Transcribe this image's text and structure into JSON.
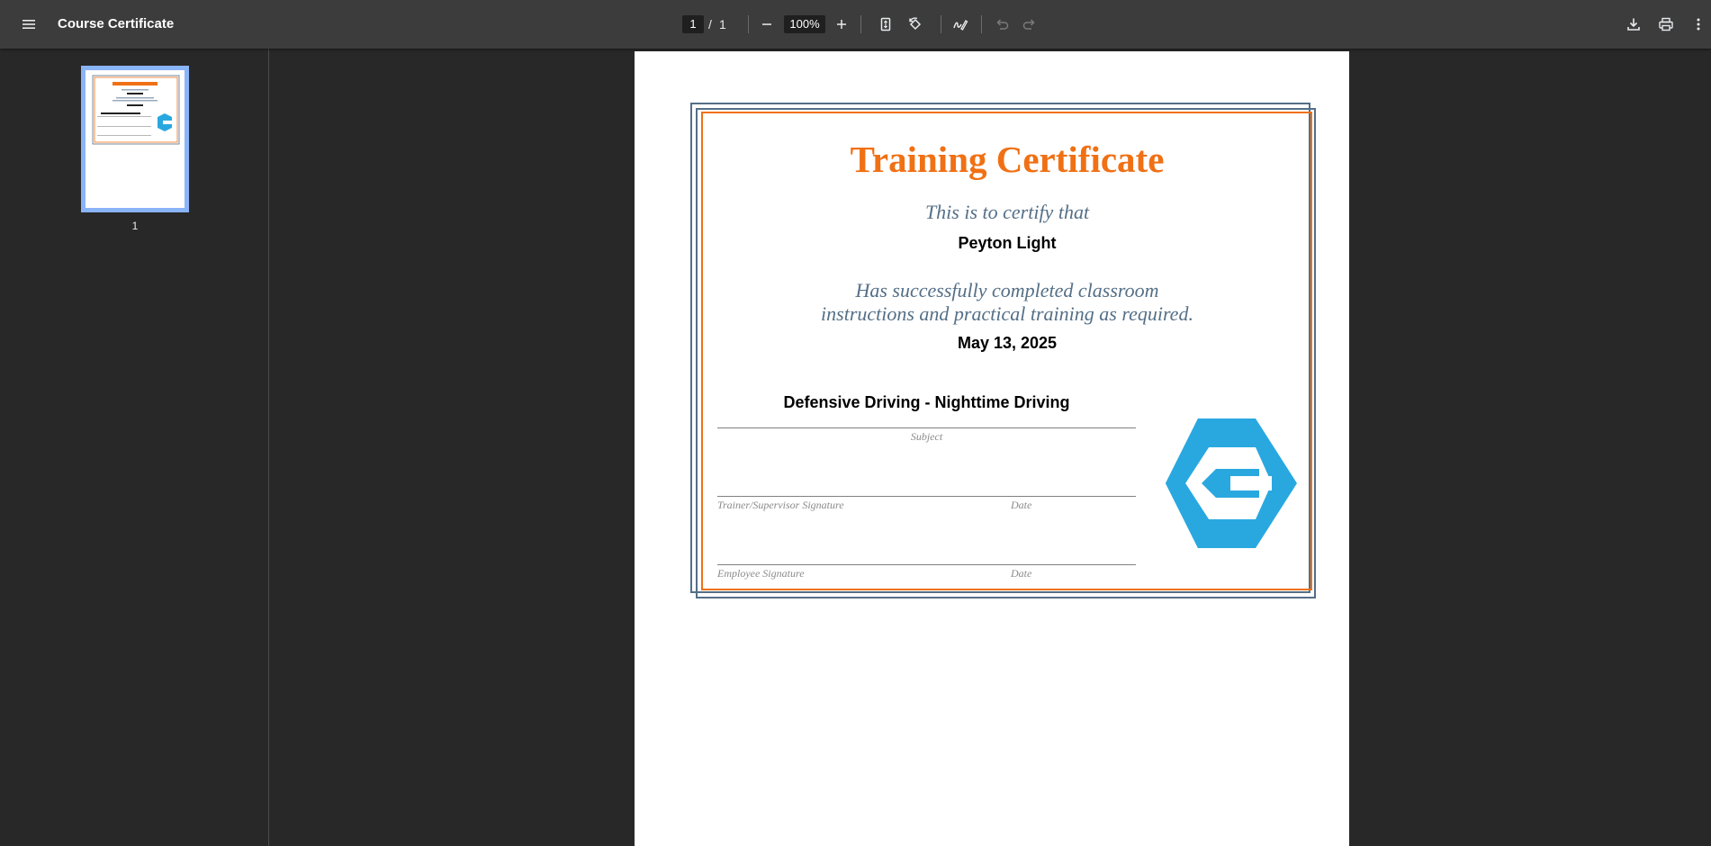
{
  "app": {
    "title": "Course Certificate",
    "page_current": "1",
    "page_separator": "/",
    "page_total": "1",
    "zoom": "100%"
  },
  "toolbar": {
    "menu_icon": "menu-icon",
    "zoom_out_icon": "minus-icon",
    "zoom_in_icon": "plus-icon",
    "fit_icon": "fit-page-icon",
    "rotate_icon": "rotate-icon",
    "annotate_icon": "draw-icon",
    "undo_icon": "undo-icon",
    "redo_icon": "redo-icon",
    "download_icon": "download-icon",
    "print_icon": "print-icon",
    "more_icon": "more-vert-icon"
  },
  "sidebar": {
    "thumbnails": [
      {
        "label": "1"
      }
    ]
  },
  "certificate": {
    "title": "Training Certificate",
    "certify_line": "This is to certify that",
    "name": "Peyton Light",
    "completion_line1": "Has successfully completed classroom",
    "completion_line2": "instructions and practical training as required.",
    "date": "May 13, 2025",
    "subject": "Defensive Driving - Nighttime Driving",
    "subject_caption": "Subject",
    "trainer_caption": "Trainer/Supervisor Signature",
    "date_caption_1": "Date",
    "employee_caption": "Employee Signature",
    "date_caption_2": "Date"
  },
  "colors": {
    "accent_orange": "#f07014",
    "frame_blue": "#546f87",
    "logo_blue": "#29a8e0",
    "toolbar_bg": "#3c3c3c",
    "viewer_bg": "#282828",
    "thumbnail_selected": "#8ab4f8"
  }
}
